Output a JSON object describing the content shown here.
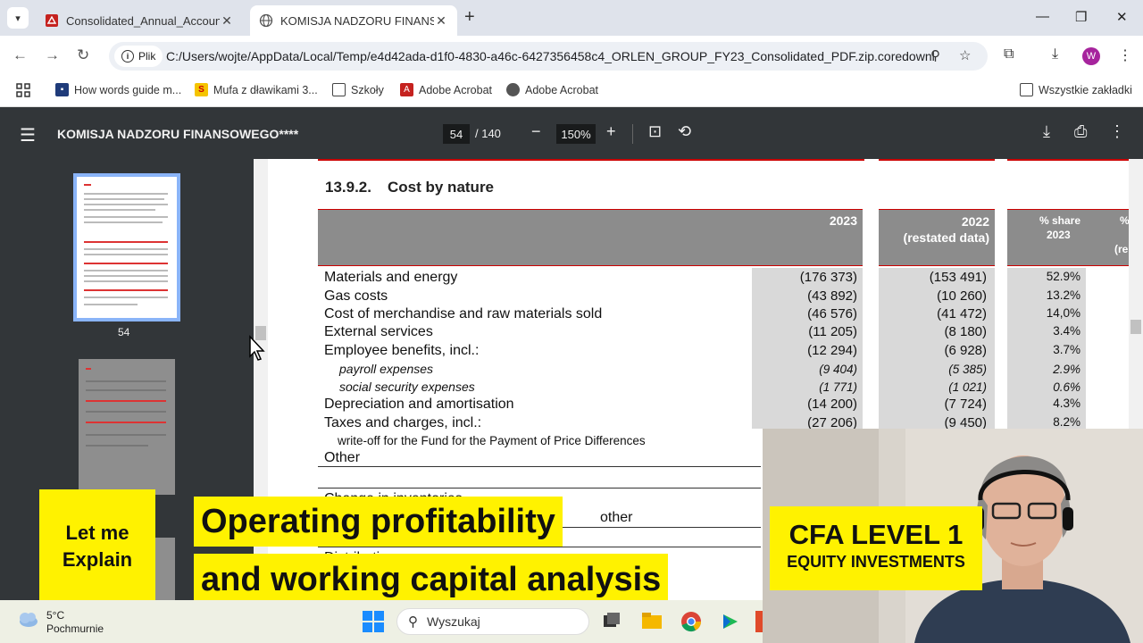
{
  "browser": {
    "tabs": [
      {
        "title": "Consolidated_Annual_Accounts",
        "active": false
      },
      {
        "title": "KOMISJA NADZORU FINANSOW",
        "active": true
      }
    ],
    "site_chip": "Plik",
    "url": "C:/Users/wojte/AppData/Local/Temp/e4d42ada-d1f0-4830-a46c-6427356458c4_ORLEN_GROUP_FY23_Consolidated_PDF.zip.coredownl...",
    "avatar_letter": "W",
    "bookmarks": [
      "How words guide m...",
      "Mufa z dławikami 3...",
      "Szkoły",
      "Adobe Acrobat",
      "Adobe Acrobat"
    ],
    "all_bookmarks": "Wszystkie zakładki"
  },
  "pdf": {
    "title": "KOMISJA NADZORU FINANSOWEGO****",
    "page": "54",
    "total": "/ 140",
    "zoom": "150%",
    "thumb_label": "54"
  },
  "document": {
    "section_number": "13.9.2.",
    "section_title": "Cost by nature",
    "headers": {
      "c2023": "2023",
      "c2022": "2022",
      "c2022_note": "(restated data)",
      "share": "% share",
      "share_year": "2023",
      "cut1": "%",
      "cut2": "(re"
    },
    "rows": [
      {
        "label": "Materials and energy",
        "v2023": "(176 373)",
        "v2022": "(153 491)",
        "share": "52.9%"
      },
      {
        "label": "Gas costs",
        "v2023": "(43 892)",
        "v2022": "(10 260)",
        "share": "13.2%"
      },
      {
        "label": "Cost of merchandise and raw materials sold",
        "v2023": "(46 576)",
        "v2022": "(41 472)",
        "share": "14,0%"
      },
      {
        "label": "External services",
        "v2023": "(11 205)",
        "v2022": "(8 180)",
        "share": "3.4%"
      },
      {
        "label": "Employee benefits, incl.:",
        "v2023": "(12 294)",
        "v2022": "(6 928)",
        "share": "3.7%"
      },
      {
        "label": "payroll expenses",
        "v2023": "(9 404)",
        "v2022": "(5 385)",
        "share": "2.9%"
      },
      {
        "label": "social security expenses",
        "v2023": "(1 771)",
        "v2022": "(1 021)",
        "share": "0.6%"
      },
      {
        "label": "Depreciation and amortisation",
        "v2023": "(14 200)",
        "v2022": "(7 724)",
        "share": "4.3%"
      },
      {
        "label": "Taxes and charges, incl.:",
        "v2023": "(27 206)",
        "v2022": "(9 450)",
        "share": "8.2%"
      },
      {
        "label": "write-off for the Fund for the Payment of Price Differences",
        "v2023": "",
        "v2022": "",
        "share": ""
      },
      {
        "label": "Other",
        "v2023": "",
        "v2022": "",
        "share": ""
      }
    ],
    "partial_1": "Change in inventories",
    "partial_2": "other",
    "partial_3": "Distribution expenses"
  },
  "overlay": {
    "badge_line1": "Let me",
    "badge_line2": "Explain",
    "headline_1": "Operating profitability",
    "headline_2": "and working capital analysis",
    "cfa_title": "CFA LEVEL 1",
    "cfa_sub": "EQUITY INVESTMENTS"
  },
  "taskbar": {
    "temp": "5°C",
    "weather": "Pochmurnie",
    "search": "Wyszukaj"
  }
}
